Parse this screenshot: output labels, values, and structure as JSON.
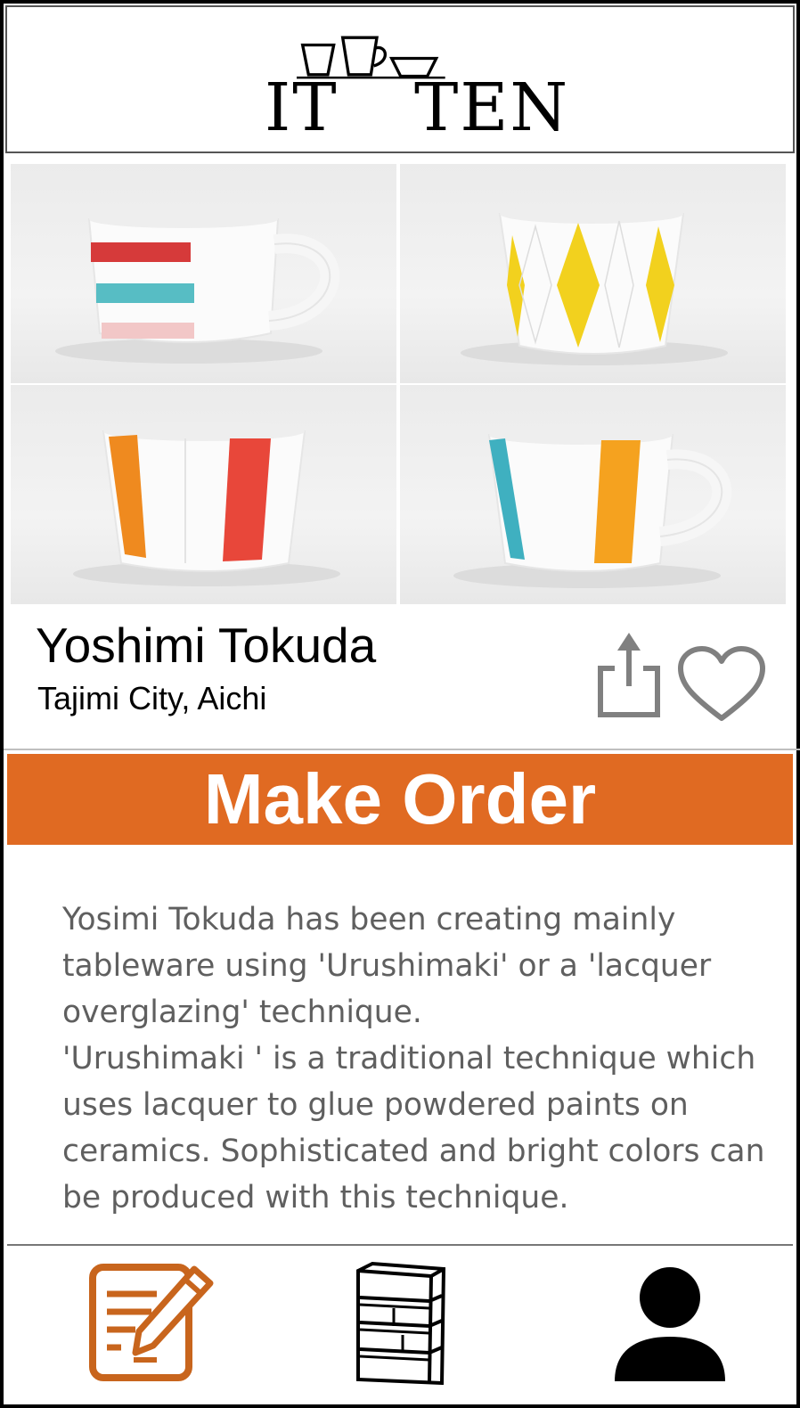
{
  "header": {
    "logo_text_left": "IT",
    "logo_text_right": "TEN"
  },
  "artist": {
    "name": "Yoshimi Tokuda",
    "location": "Tajimi City, Aichi"
  },
  "actions": {
    "share_icon": "share-icon",
    "favorite_icon": "heart-icon"
  },
  "order": {
    "label": "Make Order",
    "color": "#e06a22"
  },
  "description": "Yosimi Tokuda has been creating mainly tableware using 'Urushimaki' or a 'lacquer overglazing' technique.\n'Urushimaki ' is a traditional technique which uses lacquer to glue powdered paints on ceramics. Sophisticated and bright colors can be produced with this technique.",
  "nav": {
    "items": [
      {
        "icon": "edit-order-icon",
        "color": "#c8651d"
      },
      {
        "icon": "shelf-icon",
        "color": "#000000"
      },
      {
        "icon": "user-icon",
        "color": "#000000"
      }
    ]
  }
}
